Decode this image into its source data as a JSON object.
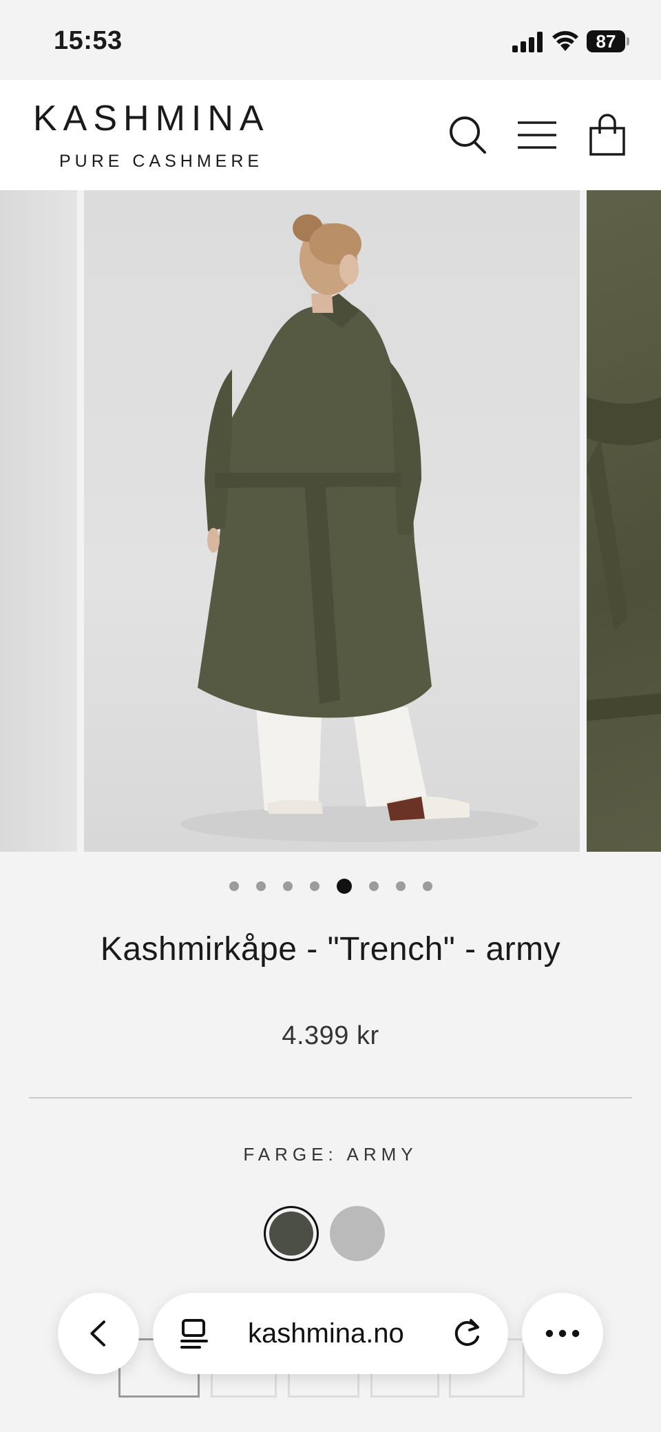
{
  "status_bar": {
    "time": "15:53",
    "battery": "87"
  },
  "header": {
    "logo_main": "KASHMINA",
    "logo_sub": "PURE CASHMERE"
  },
  "icons": [
    "search-icon",
    "menu-icon",
    "cart-bag-icon",
    "zoom-icon",
    "back-chevron-icon",
    "reader-icon",
    "reload-icon",
    "more-icon"
  ],
  "gallery": {
    "total_images": 8,
    "active_index": 4
  },
  "product": {
    "title": "Kashmirkåpe - \"Trench\" - army",
    "price": "4.399 kr",
    "color_label": "FARGE: ARMY",
    "swatches": [
      {
        "name": "army",
        "color": "#4b4f45",
        "selected": true
      },
      {
        "name": "grey",
        "color": "#bababa",
        "selected": false
      }
    ]
  },
  "browser": {
    "url": "kashmina.no"
  }
}
